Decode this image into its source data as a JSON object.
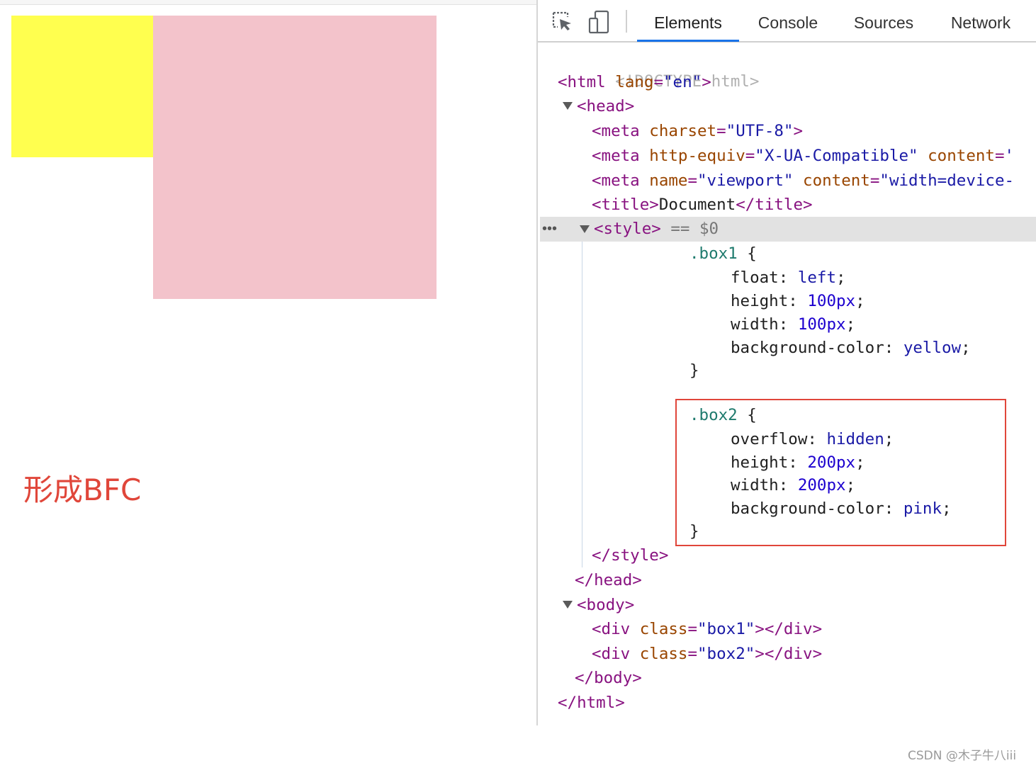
{
  "preview": {
    "annotation": "形成BFC",
    "box1_color": "#ffff4f",
    "box2_color": "#f3c3cb"
  },
  "devtools": {
    "tabs": [
      "Elements",
      "Console",
      "Sources",
      "Network"
    ],
    "active_tab": "Elements",
    "toolbar_icons": [
      "inspect-element-icon",
      "device-toolbar-icon"
    ],
    "selected_hint": "== $0",
    "lines": {
      "doctype": "<!DOCTYPE html>",
      "html_open": {
        "tag": "<html",
        "attr": "lang",
        "val": "\"en\"",
        "end": ">"
      },
      "head_open": "<head>",
      "meta1": {
        "tag": "<meta",
        "attr": "charset",
        "val": "\"UTF-8\"",
        "end": ">"
      },
      "meta2": {
        "tag": "<meta",
        "attr1": "http-equiv",
        "val1": "\"X-UA-Compatible\"",
        "attr2": "content",
        "val2": "'"
      },
      "meta3": {
        "tag": "<meta",
        "attr1": "name",
        "val1": "\"viewport\"",
        "attr2": "content",
        "val2": "\"width=device-"
      },
      "title": {
        "open": "<title>",
        "text": "Document",
        "close": "</title>"
      },
      "style_open": "<style>",
      "box1": {
        "selector": ".box1",
        "props": [
          {
            "name": "float",
            "value": "left"
          },
          {
            "name": "height",
            "value": "100px"
          },
          {
            "name": "width",
            "value": "100px"
          },
          {
            "name": "background-color",
            "value": "yellow"
          }
        ]
      },
      "box2": {
        "selector": ".box2",
        "props": [
          {
            "name": "overflow",
            "value": "hidden"
          },
          {
            "name": "height",
            "value": "200px"
          },
          {
            "name": "width",
            "value": "200px"
          },
          {
            "name": "background-color",
            "value": "pink"
          }
        ]
      },
      "style_close": "</style>",
      "head_close": "</head>",
      "body_open": "<body>",
      "div1": {
        "tag": "<div",
        "attr": "class",
        "val": "\"box1\"",
        "end": "></div>"
      },
      "div2": {
        "tag": "<div",
        "attr": "class",
        "val": "\"box2\"",
        "end": "></div>"
      },
      "body_close": "</body>",
      "html_close": "</html>"
    }
  },
  "watermark": "CSDN @木子牛八iii",
  "colors": {
    "accent": "#1a73e8",
    "highlight_border": "#e0463a"
  }
}
